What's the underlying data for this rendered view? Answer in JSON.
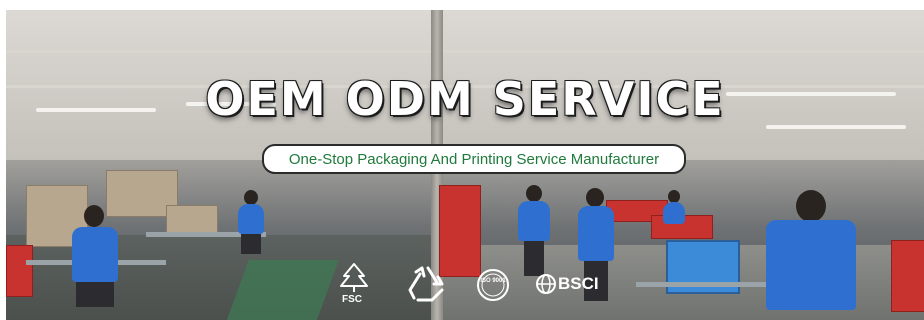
{
  "banner": {
    "title": "OEM ODM SERVICE",
    "subtitle": "One-Stop Packaging And Printing Service Manufacturer"
  },
  "certifications": [
    {
      "name": "FSC",
      "icon": "fsc-tree-icon",
      "label": "FSC"
    },
    {
      "name": "Recycle",
      "icon": "recycle-icon",
      "label": ""
    },
    {
      "name": "ISO 9001",
      "icon": "iso-seal-icon",
      "label": "ISO 9001"
    },
    {
      "name": "BSCI",
      "icon": "bsci-globe-icon",
      "label": "BSCI"
    }
  ],
  "colors": {
    "subtitle_text": "#1f7a3c",
    "worker_uniform": "#2f6fd0",
    "crate": "#c9332f"
  }
}
